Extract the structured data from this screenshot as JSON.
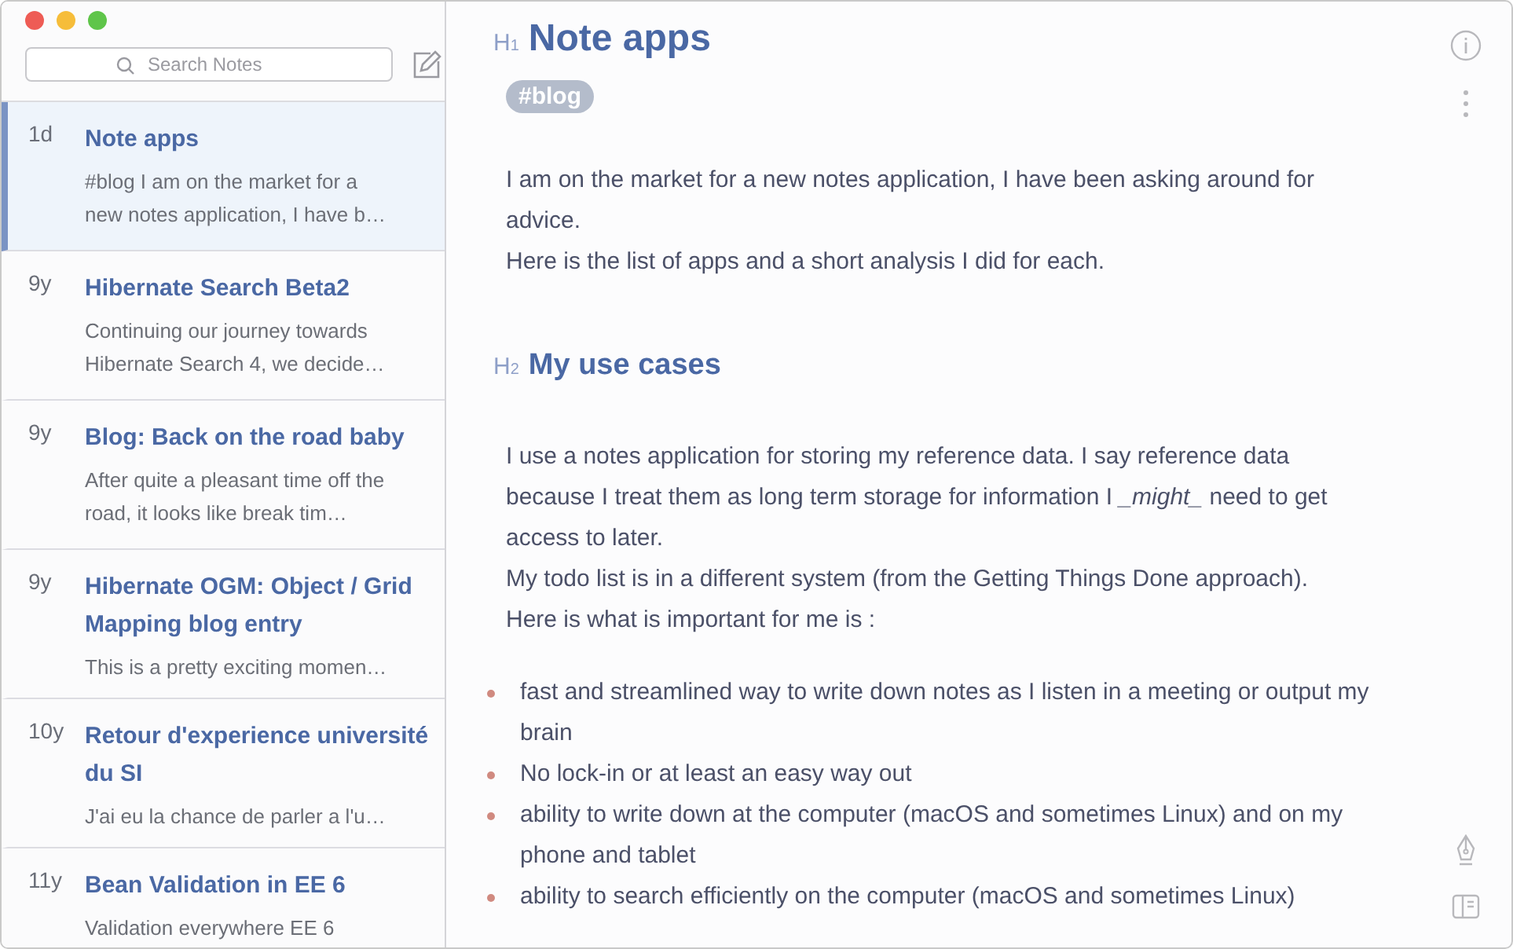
{
  "search": {
    "placeholder": "Search Notes"
  },
  "notes": [
    {
      "age": "1d",
      "title": "Note apps",
      "preview": "#blog I am on the market for a new notes application, I have b…",
      "selected": true
    },
    {
      "age": "9y",
      "title": "Hibernate Search Beta2",
      "preview": "Continuing our journey towards Hibernate Search 4, we decide…",
      "selected": false
    },
    {
      "age": "9y",
      "title": "Blog: Back on the road baby",
      "preview": "After quite a pleasant time off the road, it looks like break tim…",
      "selected": false
    },
    {
      "age": "9y",
      "title": "Hibernate OGM: Object / Grid Mapping blog entry",
      "preview": "This is a pretty exciting momen…",
      "selected": false
    },
    {
      "age": "10y",
      "title": "Retour d'experience université du SI",
      "preview": "J'ai eu la chance de parler a l'u…",
      "selected": false
    },
    {
      "age": "11y",
      "title": "Bean Validation in EE 6",
      "preview": "Validation everywhere EE 6",
      "selected": false
    }
  ],
  "document": [
    {
      "kind": "title",
      "marker": "H$_{1}$",
      "text": "Note apps"
    },
    {
      "kind": "tag",
      "text": "#blog"
    },
    {
      "kind": "paragraph",
      "lines": [
        "I am on the market for a new notes application, I have been asking around for advice.",
        "Here is the list of apps and a short analysis I did for each."
      ]
    },
    {
      "kind": "heading",
      "marker": "H$_{2}$",
      "text": "My use cases"
    },
    {
      "kind": "paragraph",
      "lines": [
        "I use a notes application for storing my reference data. I say reference data because I treat them as long term storage for information I *_might_* need to get access to later.",
        "My todo list is in a different system (from the Getting Things Done approach).",
        "Here is what is important for me is :"
      ]
    },
    {
      "kind": "bullets",
      "items": [
        "fast and streamlined way to write down notes as I listen in a meeting or output my brain",
        "No lock-in or at least an easy way out",
        "ability to write down at the computer (macOS and sometimes Linux) and on my phone and tablet",
        "ability to search efficiently on the computer (macOS and sometimes Linux)"
      ]
    }
  ]
}
